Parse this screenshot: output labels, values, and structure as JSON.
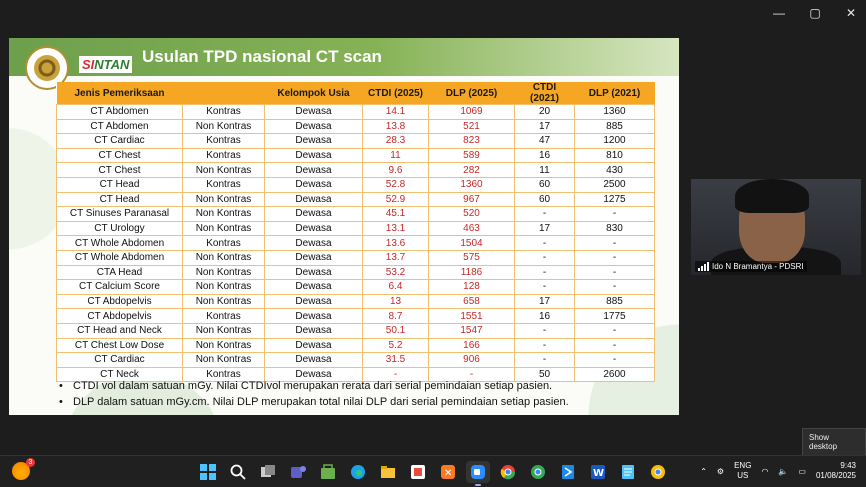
{
  "window": {
    "controls": [
      "—",
      "▢",
      "✕"
    ]
  },
  "slide": {
    "title": "Usulan TPD nasional  CT scan",
    "logo_text_a": "SI",
    "logo_text_b": "NTAN",
    "emblem_label": "BAPETEN"
  },
  "table": {
    "headers": [
      "Jenis Pemeriksaan",
      "",
      "Kelompok Usia",
      "CTDI (2025)",
      "DLP (2025)",
      "CTDI (2021)",
      "DLP (2021)"
    ],
    "rows": [
      [
        "CT Abdomen",
        "Kontras",
        "Dewasa",
        "14.1",
        "1069",
        "20",
        "1360"
      ],
      [
        "CT Abdomen",
        "Non Kontras",
        "Dewasa",
        "13.8",
        "521",
        "17",
        "885"
      ],
      [
        "CT Cardiac",
        "Kontras",
        "Dewasa",
        "28.3",
        "823",
        "47",
        "1200"
      ],
      [
        "CT Chest",
        "Kontras",
        "Dewasa",
        "11",
        "589",
        "16",
        "810"
      ],
      [
        "CT Chest",
        "Non Kontras",
        "Dewasa",
        "9.6",
        "282",
        "11",
        "430"
      ],
      [
        "CT Head",
        "Kontras",
        "Dewasa",
        "52.8",
        "1360",
        "60",
        "2500"
      ],
      [
        "CT Head",
        "Non Kontras",
        "Dewasa",
        "52.9",
        "967",
        "60",
        "1275"
      ],
      [
        "CT Sinuses Paranasal",
        "Non Kontras",
        "Dewasa",
        "45.1",
        "520",
        "-",
        "-"
      ],
      [
        "CT Urology",
        "Non Kontras",
        "Dewasa",
        "13.1",
        "463",
        "17",
        "830"
      ],
      [
        "CT Whole Abdomen",
        "Kontras",
        "Dewasa",
        "13.6",
        "1504",
        "-",
        "-"
      ],
      [
        "CT Whole Abdomen",
        "Non Kontras",
        "Dewasa",
        "13.7",
        "575",
        "-",
        "-"
      ],
      [
        "CTA Head",
        "Non Kontras",
        "Dewasa",
        "53.2",
        "1186",
        "-",
        "-"
      ],
      [
        "CT Calcium Score",
        "Non Kontras",
        "Dewasa",
        "6.4",
        "128",
        "-",
        "-"
      ],
      [
        "CT Abdopelvis",
        "Non Kontras",
        "Dewasa",
        "13",
        "658",
        "17",
        "885"
      ],
      [
        "CT Abdopelvis",
        "Kontras",
        "Dewasa",
        "8.7",
        "1551",
        "16",
        "1775"
      ],
      [
        "CT Head and Neck",
        "Non Kontras",
        "Dewasa",
        "50.1",
        "1547",
        "-",
        "-"
      ],
      [
        "CT Chest Low Dose",
        "Non Kontras",
        "Dewasa",
        "5.2",
        "166",
        "-",
        "-"
      ],
      [
        "CT Cardiac",
        "Non Kontras",
        "Dewasa",
        "31.5",
        "906",
        "-",
        "-"
      ],
      [
        "CT Neck",
        "Kontras",
        "Dewasa",
        "-",
        "-",
        "50",
        "2600"
      ]
    ]
  },
  "notes": [
    "CTDI vol dalam satuan mGy. Nilai CTDIvol merupakan rerata dari serial pemindaian setiap pasien.",
    "DLP dalam satuan mGy.cm. Nilai DLP merupakan total nilai DLP dari serial pemindaian setiap pasien."
  ],
  "video": {
    "participant_name": "Ido N Bramantya - PDSRI"
  },
  "show_desktop": "Show desktop",
  "taskbar": {
    "weather_badge": "3",
    "apps": [
      "windows-start",
      "search",
      "task-view",
      "teams",
      "store-green",
      "edge",
      "file-explorer",
      "office",
      "xampp",
      "zoom",
      "chrome",
      "chrome-alt",
      "vscode",
      "word",
      "notepad",
      "chrome-dev"
    ],
    "lang_line1": "ENG",
    "lang_line2": "US",
    "time": "9:43",
    "date": "01/08/2025"
  },
  "colors": {
    "header": "#f5a623",
    "title_bar": "#86b256",
    "value_red": "#c62828"
  }
}
